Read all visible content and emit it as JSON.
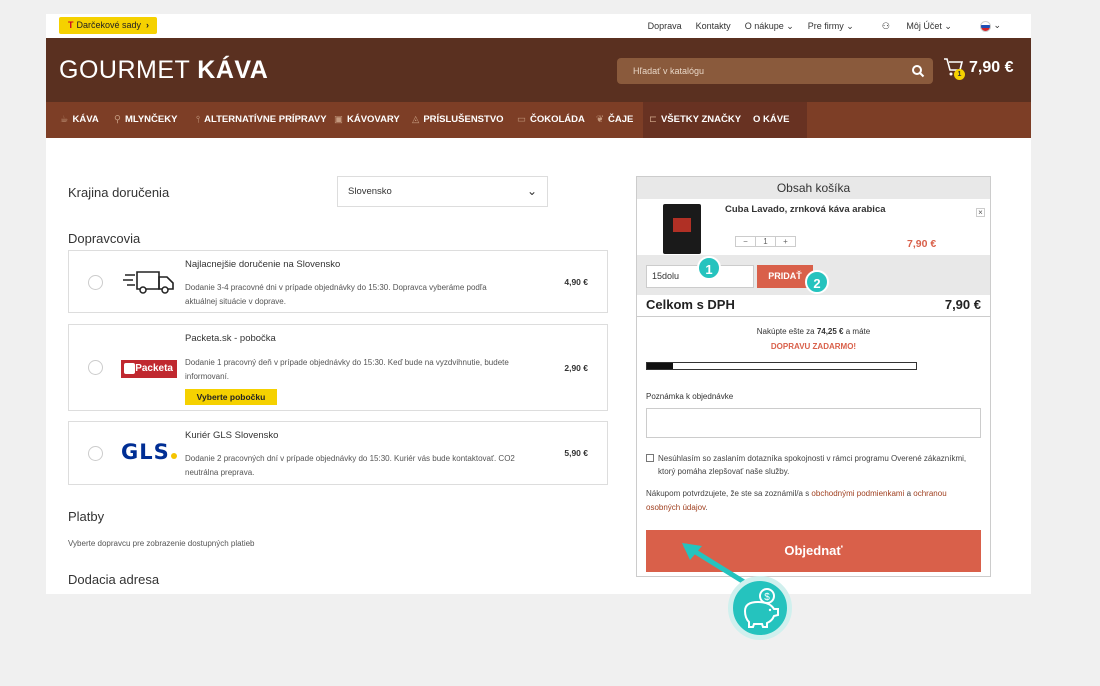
{
  "topbar": {
    "gift_label": "Darčekové sady",
    "links": [
      "Doprava",
      "Kontakty",
      "O nákupe ⌄",
      "Pre firmy ⌄",
      "Môj Účet ⌄"
    ]
  },
  "header": {
    "logo_light": "GOURMET",
    "logo_bold": "KÁVA",
    "search_placeholder": "Hľadať v katalógu",
    "cart_count": "1",
    "cart_total": "7,90 €"
  },
  "nav": {
    "items": [
      "KÁVA",
      "MLYNČEKY",
      "ALTERNATÍVNE PRÍPRAVY",
      "KÁVOVARY",
      "PRÍSLUŠENSTVO",
      "ČOKOLÁDA",
      "ČAJE",
      "VŠETKY ZNAČKY",
      "O KÁVE"
    ]
  },
  "delivery": {
    "country_label": "Krajina doručenia",
    "country_value": "Slovensko",
    "carriers_heading": "Dopravcovia",
    "carriers": [
      {
        "title": "Najlacnejšie doručenie na Slovensko",
        "desc": "Dodanie 3-4 pracovné dni v prípade objednávky do 15:30. Dopravca vyberáme podľa aktuálnej situácie v doprave.",
        "price": "4,90 €"
      },
      {
        "title": "Packeta.sk - pobočka",
        "desc": "Dodanie 1 pracovný deň v prípade objednávky do 15:30. Keď bude na vyzdvihnutie, budete informovaní.",
        "price": "2,90 €",
        "button": "Vyberte pobočku",
        "logo": "Packeta"
      },
      {
        "title": "Kuriér GLS Slovensko",
        "desc": "Dodanie 2 pracovných dní v prípade objednávky do 15:30. Kuriér vás bude kontaktovať. CO2 neutrálna preprava.",
        "price": "5,90 €",
        "logo": "GLS"
      }
    ],
    "payments_heading": "Platby",
    "payments_note": "Vyberte dopravcu pre zobrazenie dostupných platieb",
    "address_heading": "Dodacia adresa"
  },
  "cart": {
    "heading": "Obsah košíka",
    "product_name": "Cuba Lavado, zrnková káva arabica",
    "qty_minus": "−",
    "qty_value": "1",
    "qty_plus": "+",
    "product_price": "7,90 €",
    "coupon_value": "15dolu",
    "coupon_button": "PRIDAŤ",
    "total_label": "Celkom s DPH",
    "total_value": "7,90 €",
    "free_pre": "Nakúpte ešte za",
    "free_amount": "74,25 €",
    "free_post": "a máte",
    "free_shipping": "DOPRAVU ZADARMO!",
    "free_progress": 0.096,
    "note_label": "Poznámka k objednávke",
    "consent_text": "Nesúhlasím so zaslaním dotazníka spokojnosti v rámci programu Overené zákazníkmi, ktorý pomáha zlepšovať naše služby.",
    "terms_pre": "Nákupom potvrdzujete, že ste sa zoznámil/a s",
    "terms_link1": "obchodnými podmienkami",
    "terms_mid": "a",
    "terms_link2": "ochranou osobných údajov",
    "terms_end": ".",
    "order_button": "Objednať"
  },
  "callouts": [
    "1",
    "2"
  ],
  "colors": {
    "header": "#5a3020",
    "nav": "#7d3e26",
    "accent": "#d9604a",
    "callout": "#25c3be",
    "gift": "#f5d100"
  }
}
